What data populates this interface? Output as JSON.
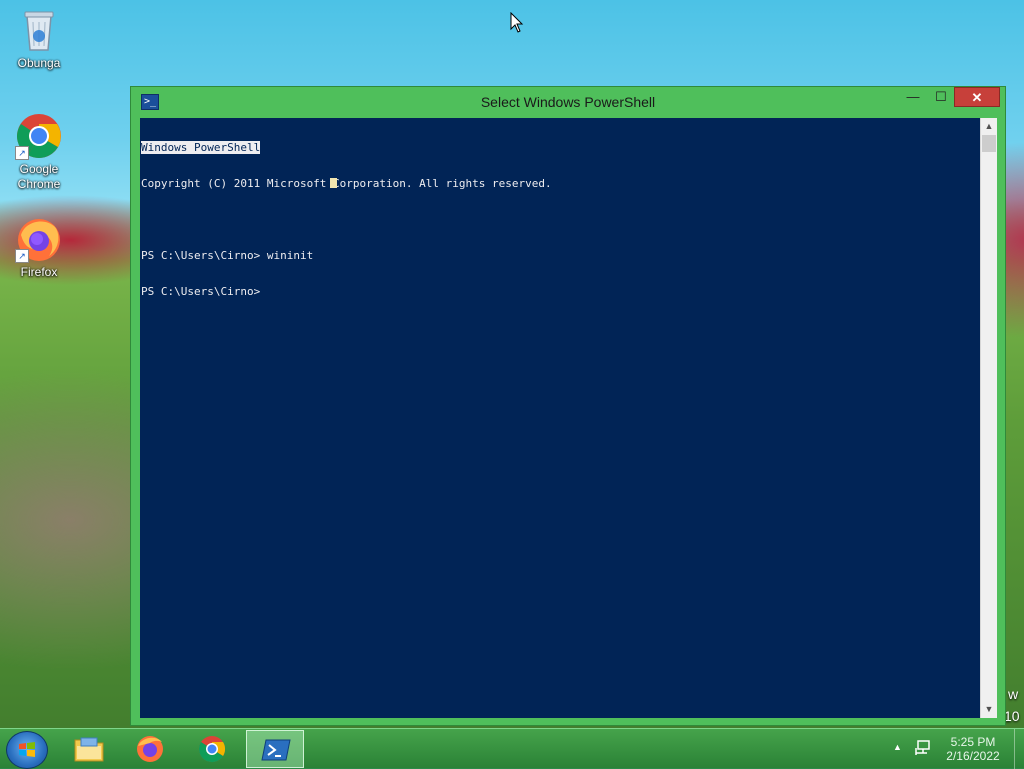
{
  "desktop": {
    "icons": [
      {
        "label": "Obunga",
        "icon": "recycle-bin-icon"
      },
      {
        "label": "Google\nChrome",
        "icon": "chrome-icon"
      },
      {
        "label": "Firefox",
        "icon": "firefox-icon"
      }
    ],
    "behind_text": [
      "w",
      "10"
    ]
  },
  "window": {
    "title": "Select Windows PowerShell",
    "icon": "powershell-icon",
    "buttons": {
      "minimize": "—",
      "maximize": "☐",
      "close": "✕"
    },
    "console_lines": [
      "Windows PowerShell",
      "Copyright (C) 2011 Microsoft Corporation. All rights reserved.",
      "",
      "PS C:\\Users\\Cirno> wininit",
      "PS C:\\Users\\Cirno>"
    ],
    "colors": {
      "console_bg": "#012456",
      "console_fg": "#eeedf0",
      "frame": "#4fbf5b",
      "close": "#c7403a"
    }
  },
  "taskbar": {
    "apps": [
      {
        "name": "file-explorer",
        "icon": "folder-icon",
        "active": false
      },
      {
        "name": "firefox",
        "icon": "firefox-icon",
        "active": false
      },
      {
        "name": "chrome",
        "icon": "chrome-icon",
        "active": false
      },
      {
        "name": "powershell",
        "icon": "powershell-icon",
        "active": true
      }
    ],
    "tray": {
      "time": "5:25 PM",
      "date": "2/16/2022",
      "chevron": "▲"
    }
  }
}
